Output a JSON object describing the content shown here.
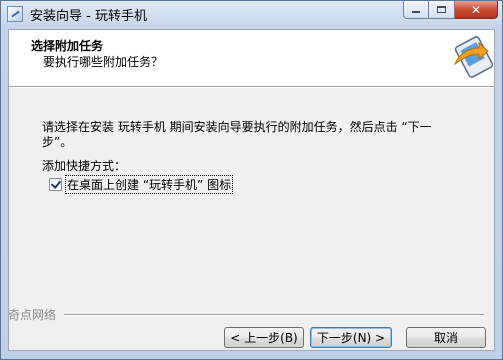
{
  "window": {
    "title": "安装向导 - 玩转手机",
    "minimize_label": "",
    "maximize_label": "",
    "close_label": "✕"
  },
  "header": {
    "title": "选择附加任务",
    "subtitle": "要执行哪些附加任务？"
  },
  "body": {
    "instruction": "请选择在安装 玩转手机 期间安装向导要执行的附加任务，然后点击 “下一步”。",
    "section_label": "添加快捷方式：",
    "checkbox": {
      "label": "在桌面上创建 “玩转手机” 图标",
      "checked": true
    }
  },
  "footer": {
    "brand": "奇点网络",
    "back_label": "< 上一步(B)",
    "next_label": "下一步(N) >",
    "cancel_label": "取消"
  },
  "colors": {
    "accent": "#3c7fb1",
    "close_button": "#c94b32"
  }
}
